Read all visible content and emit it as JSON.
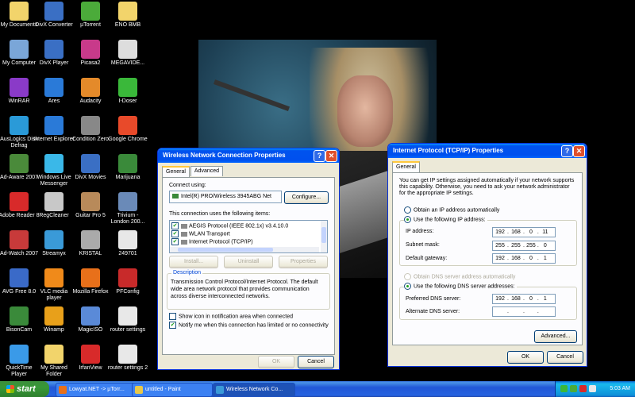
{
  "desktop_icons": [
    {
      "label": "My Documents",
      "color": "#f2d46b"
    },
    {
      "label": "DivX Converter",
      "color": "#3a6fc4"
    },
    {
      "label": "µTorrent",
      "color": "#4bab3a"
    },
    {
      "label": "ENO BMB",
      "color": "#f2d46b"
    },
    {
      "label": "My Computer",
      "color": "#7aa6d8"
    },
    {
      "label": "DivX Player",
      "color": "#3a6fc4"
    },
    {
      "label": "Picasa2",
      "color": "#c83a8a"
    },
    {
      "label": "MEGAVIDE...",
      "color": "#dddddd"
    },
    {
      "label": "WinRAR",
      "color": "#8a3ac8"
    },
    {
      "label": "Ares",
      "color": "#2a7ad8"
    },
    {
      "label": "Audacity",
      "color": "#e48a2a"
    },
    {
      "label": "I-Doser",
      "color": "#3ab83a"
    },
    {
      "label": "AusLogics Disk Defrag",
      "color": "#2a9ad8"
    },
    {
      "label": "Internet Explorer",
      "color": "#2a7ad8"
    },
    {
      "label": "Condition Zero",
      "color": "#888888"
    },
    {
      "label": "Google Chrome",
      "color": "#e84a2a"
    },
    {
      "label": "Ad-Aware 2007",
      "color": "#4a8a3a"
    },
    {
      "label": "Windows Live Messenger",
      "color": "#3ab8e8"
    },
    {
      "label": "DivX Movies",
      "color": "#3a6fc4"
    },
    {
      "label": "Marijuana",
      "color": "#3a8a3a"
    },
    {
      "label": "Adobe Reader 8",
      "color": "#d82a2a"
    },
    {
      "label": "RegCleaner",
      "color": "#c8c8c8"
    },
    {
      "label": "Guitar Pro 5",
      "color": "#b88a5a"
    },
    {
      "label": "Trivium - London 200...",
      "color": "#6a8ab8"
    },
    {
      "label": "Ad-Watch 2007",
      "color": "#c83a3a"
    },
    {
      "label": "Streamyx",
      "color": "#3a9ad8"
    },
    {
      "label": "KRISTAL",
      "color": "#aaaaaa"
    },
    {
      "label": "249701",
      "color": "#e8e8e8"
    },
    {
      "label": "AVG Free 8.0",
      "color": "#3a6ac8"
    },
    {
      "label": "VLC media player",
      "color": "#f08a1a"
    },
    {
      "label": "Mozilla Firefox",
      "color": "#e8701a"
    },
    {
      "label": "PFConfig",
      "color": "#c82a2a"
    },
    {
      "label": "BisonCam",
      "color": "#3a8a3a"
    },
    {
      "label": "Winamp",
      "color": "#e8a01a"
    },
    {
      "label": "MagicISO",
      "color": "#5a8ad8"
    },
    {
      "label": "router settings",
      "color": "#e8e8e8"
    },
    {
      "label": "QuickTime Player",
      "color": "#3a9ae8"
    },
    {
      "label": "My Shared Folder",
      "color": "#f2d46b"
    },
    {
      "label": "IrfanView",
      "color": "#d82a2a"
    },
    {
      "label": "router settings 2",
      "color": "#e8e8e8"
    }
  ],
  "conn_window": {
    "title": "Wireless Network Connection Properties",
    "tabs": [
      "General",
      "Advanced"
    ],
    "connect_using_label": "Connect using:",
    "adapter": "Intel(R) PRO/Wireless 3945ABG Net",
    "configure_label": "Configure...",
    "items_label": "This connection uses the following items:",
    "items": [
      {
        "label": "AEGIS Protocol (IEEE 802.1x) v3.4.10.0"
      },
      {
        "label": "WLAN Transport"
      },
      {
        "label": "Internet Protocol (TCP/IP)"
      }
    ],
    "install_label": "Install...",
    "uninstall_label": "Uninstall",
    "properties_label": "Properties",
    "description_label": "Description",
    "description_text": "Transmission Control Protocol/Internet Protocol. The default wide area network protocol that provides communication across diverse interconnected networks.",
    "show_icon_label": "Show icon in notification area when connected",
    "notify_label": "Notify me when this connection has limited or no connectivity",
    "ok_label": "OK",
    "cancel_label": "Cancel"
  },
  "tcp_window": {
    "title": "Internet Protocol (TCP/IP) Properties",
    "tab": "General",
    "intro": "You can get IP settings assigned automatically if your network supports this capability. Otherwise, you need to ask your network administrator for the appropriate IP settings.",
    "obtain_ip_label": "Obtain an IP address automatically",
    "use_ip_label": "Use the following IP address:",
    "ip_label": "IP address:",
    "ip": [
      "192",
      "168",
      "0",
      "11"
    ],
    "mask_label": "Subnet mask:",
    "mask": [
      "255",
      "255",
      "255",
      "0"
    ],
    "gateway_label": "Default gateway:",
    "gateway": [
      "192",
      "168",
      "0",
      "1"
    ],
    "obtain_dns_label": "Obtain DNS server address automatically",
    "use_dns_label": "Use the following DNS server addresses:",
    "pref_dns_label": "Preferred DNS server:",
    "pref_dns": [
      "192",
      "168",
      "0",
      "1"
    ],
    "alt_dns_label": "Alternate DNS server:",
    "alt_dns": [
      "",
      "",
      "",
      ""
    ],
    "advanced_label": "Advanced...",
    "ok_label": "OK",
    "cancel_label": "Cancel"
  },
  "taskbar": {
    "start_label": "start",
    "tasks": [
      {
        "label": "Lowyat.NET -> µTorr...",
        "icon_color": "#e8701a"
      },
      {
        "label": "untitled - Paint",
        "icon_color": "#e8c84a"
      },
      {
        "label": "Wireless Network Co...",
        "icon_color": "#3a9ad8"
      }
    ],
    "clock": "5:03 AM"
  }
}
